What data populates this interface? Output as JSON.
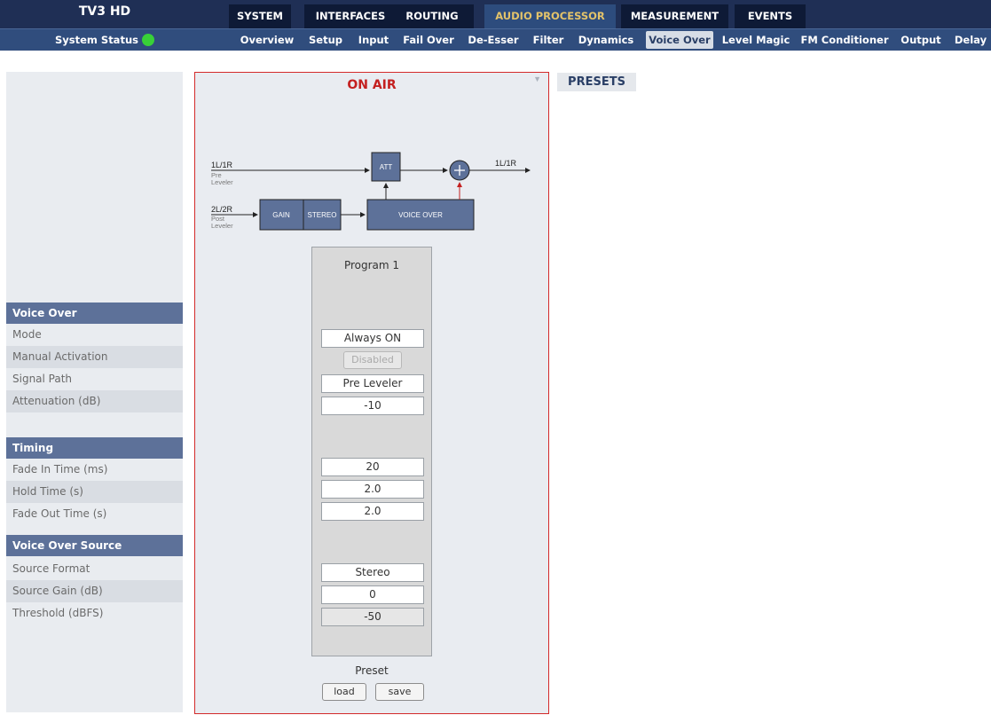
{
  "app": {
    "title": "TV3 HD"
  },
  "colors": {
    "accent": "#e3c36a",
    "on_air": "#c42020",
    "status_ok": "#38d138",
    "nav_dark": "#1f2f55",
    "section_header": "#5d7199"
  },
  "main_tabs": [
    {
      "label": "SYSTEM"
    },
    {
      "label": "INTERFACES"
    },
    {
      "label": "ROUTING"
    },
    {
      "label": "AUDIO PROCESSOR",
      "active": true
    },
    {
      "label": "MEASUREMENT"
    },
    {
      "label": "EVENTS"
    }
  ],
  "status": {
    "label": "System Status",
    "state": "ok"
  },
  "sub_tabs": [
    {
      "label": "Overview"
    },
    {
      "label": "Setup"
    },
    {
      "label": "Input"
    },
    {
      "label": "Fail Over"
    },
    {
      "label": "De-Esser"
    },
    {
      "label": "Filter"
    },
    {
      "label": "Dynamics"
    },
    {
      "label": "Voice Over",
      "active": true
    },
    {
      "label": "Level Magic"
    },
    {
      "label": "FM Conditioner"
    },
    {
      "label": "Output"
    },
    {
      "label": "Delay"
    }
  ],
  "sidebar": {
    "sections": [
      {
        "header": "Voice Over",
        "rows": [
          "Mode",
          "Manual Activation",
          "Signal Path",
          "Attenuation (dB)"
        ]
      },
      {
        "header": "Timing",
        "rows": [
          "Fade In Time (ms)",
          "Hold Time (s)",
          "Fade Out Time (s)"
        ]
      },
      {
        "header": "Voice Over Source",
        "rows": [
          "Source Format",
          "Source Gain (dB)",
          "Threshold (dBFS)"
        ]
      }
    ]
  },
  "panel": {
    "title": "ON AIR",
    "menu_icon": "dropdown-arrow-icon",
    "diagram": {
      "in1_label": "1L/1R",
      "in1_sub1": "Pre",
      "in1_sub2": "Leveler",
      "in2_label": "2L/2R",
      "in2_sub1": "Post",
      "in2_sub2": "Leveler",
      "att_label": "ATT",
      "gain_label": "GAIN",
      "stereo_label": "STEREO",
      "voice_over_label": "VOICE OVER",
      "out_label": "1L/1R"
    },
    "program": {
      "title": "Program 1",
      "mode": "Always ON",
      "manual_activation": "Disabled",
      "signal_path": "Pre Leveler",
      "attenuation": "-10",
      "fade_in": "20",
      "hold": "2.0",
      "fade_out": "2.0",
      "source_format": "Stereo",
      "source_gain": "0",
      "threshold": "-50"
    },
    "preset": {
      "label": "Preset",
      "load": "load",
      "save": "save"
    }
  },
  "presets_button": "PRESETS"
}
